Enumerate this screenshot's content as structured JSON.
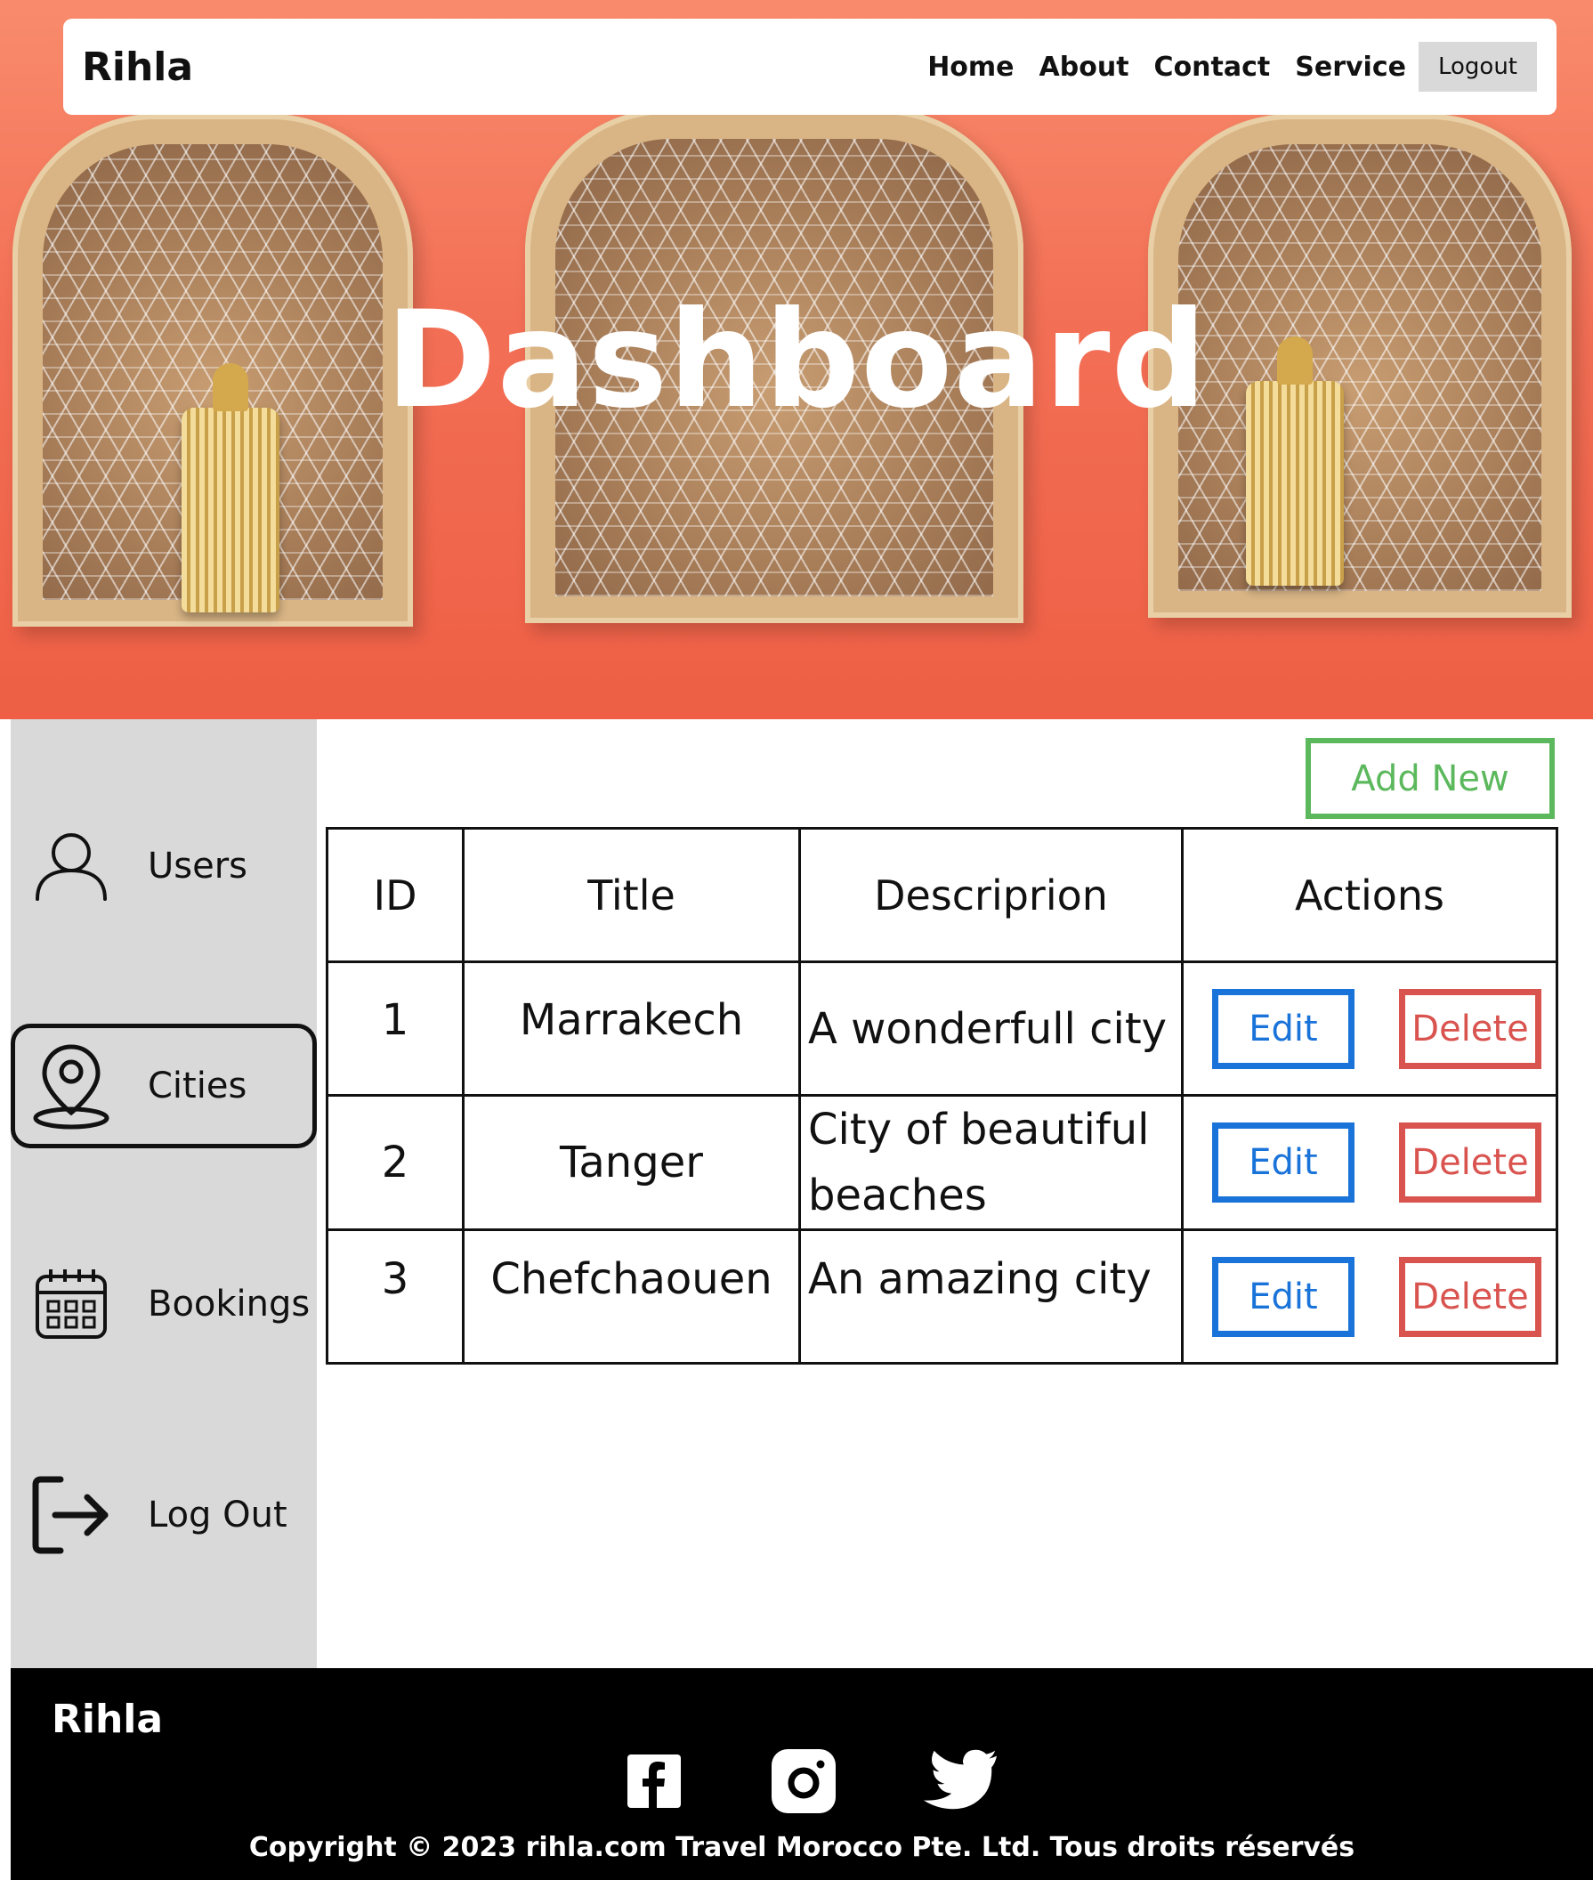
{
  "navbar": {
    "brand": "Rihla",
    "links": [
      "Home",
      "About",
      "Contact",
      "Service"
    ],
    "logout_label": "Logout"
  },
  "hero": {
    "title": "Dashboard"
  },
  "sidebar": {
    "items": [
      {
        "label": "Users",
        "icon": "user-icon"
      },
      {
        "label": "Cities",
        "icon": "map-pin-icon",
        "active": true
      },
      {
        "label": "Bookings",
        "icon": "calendar-icon"
      },
      {
        "label": "Log Out",
        "icon": "logout-icon"
      }
    ]
  },
  "main": {
    "add_new_label": "Add New",
    "table": {
      "headers": [
        "ID",
        "Title",
        "Descriprion",
        "Actions"
      ],
      "rows": [
        {
          "id": "1",
          "title": "Marrakech",
          "description": "A wonderfull city"
        },
        {
          "id": "2",
          "title": "Tanger",
          "description": "City of beautiful beaches"
        },
        {
          "id": "3",
          "title": "Chefchaouen",
          "description": "An amazing city"
        }
      ],
      "edit_label": "Edit",
      "delete_label": "Delete"
    }
  },
  "footer": {
    "brand": "Rihla",
    "social": [
      "facebook-icon",
      "instagram-icon",
      "twitter-icon"
    ],
    "copyright": "Copyright © 2023 rihla.com Travel Morocco Pte. Ltd. Tous droits réservés"
  },
  "colors": {
    "hero_bg": "#f26f55",
    "sidebar_bg": "#d9d9d9",
    "add_new": "#5cb85c",
    "edit": "#1a73d9",
    "delete": "#d9534f",
    "footer_bg": "#000000"
  }
}
